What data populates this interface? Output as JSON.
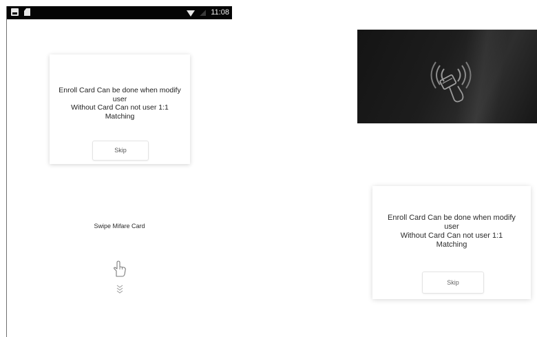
{
  "status_bar": {
    "time": "11:08",
    "left_icons": [
      "image-icon",
      "sd-card-icon"
    ],
    "right_icons": [
      "wifi-icon",
      "signal-icon"
    ]
  },
  "dialog_left": {
    "message_lines": [
      "Enroll Card Can be done when modify",
      "user",
      "Without Card Can not user 1:1",
      "Matching"
    ],
    "skip_label": "Skip"
  },
  "swipe": {
    "instruction": "Swipe Mifare Card",
    "icons": [
      "pointing-hand-icon",
      "chevrons-down-icon"
    ]
  },
  "reader_photo": {
    "icon": "nfc-card-icon"
  },
  "dialog_right": {
    "message_lines": [
      "Enroll Card Can be done when modify",
      "user",
      "Without Card Can not user 1:1",
      "Matching"
    ],
    "skip_label": "Skip"
  },
  "colors": {
    "status_bar_bg": "#050505",
    "page_bg": "#ffffff",
    "reader_bg": "#1a1a1a"
  }
}
